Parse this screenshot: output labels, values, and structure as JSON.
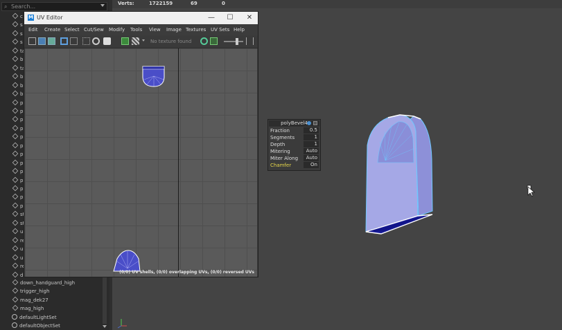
{
  "outliner": {
    "search_placeholder": "Search...",
    "truncated_rows": [
      "c",
      "s",
      "s",
      "s",
      "ta",
      "b",
      "ta",
      "b",
      "b",
      "b",
      "p",
      "p",
      "p",
      "p",
      "p",
      "p",
      "p",
      "p",
      "p",
      "p",
      "p",
      "p",
      "p",
      "st",
      "st",
      "u",
      "re",
      "u",
      "u",
      "re",
      "d"
    ],
    "items": [
      {
        "label": "down_handguard_high",
        "icon": "mesh-icon"
      },
      {
        "label": "trigger_high",
        "icon": "mesh-icon"
      },
      {
        "label": "mag_dek27",
        "icon": "mesh-icon"
      },
      {
        "label": "mag_high",
        "icon": "mesh-icon"
      },
      {
        "label": "defaultLightSet",
        "icon": "set-icon"
      },
      {
        "label": "defaultObjectSet",
        "icon": "set-icon"
      }
    ]
  },
  "stats": {
    "label": "Verts:",
    "values": [
      "1722159",
      "69",
      "0"
    ]
  },
  "uv_editor": {
    "title": "UV Editor",
    "menus": [
      "Edit",
      "Create",
      "Select",
      "Cut/Sew",
      "Modify",
      "Tools",
      "View",
      "Image",
      "Textures",
      "UV Sets",
      "Help"
    ],
    "texture_status": "No texture found",
    "status_line": "(0/0) UV shells, (0/0) overlapping UVs, (0/0) reversed UVs",
    "window_buttons": {
      "minimize": "—",
      "maximize": "☐",
      "close": "✕"
    }
  },
  "bevel": {
    "title": "polyBevel4",
    "rows": [
      {
        "label": "Fraction",
        "value": "0.5"
      },
      {
        "label": "Segments",
        "value": "1"
      },
      {
        "label": "Depth",
        "value": "1"
      },
      {
        "label": "Mitering",
        "value": "Auto"
      },
      {
        "label": "Miter Along",
        "value": "Auto"
      },
      {
        "label": "Chamfer",
        "value": "On"
      }
    ]
  },
  "colors": {
    "uv_fill": "#4a4ec8",
    "mesh_face": "#9a9ee0",
    "mesh_edge": "#5fd0ff",
    "highlight": "#e8d84a"
  }
}
